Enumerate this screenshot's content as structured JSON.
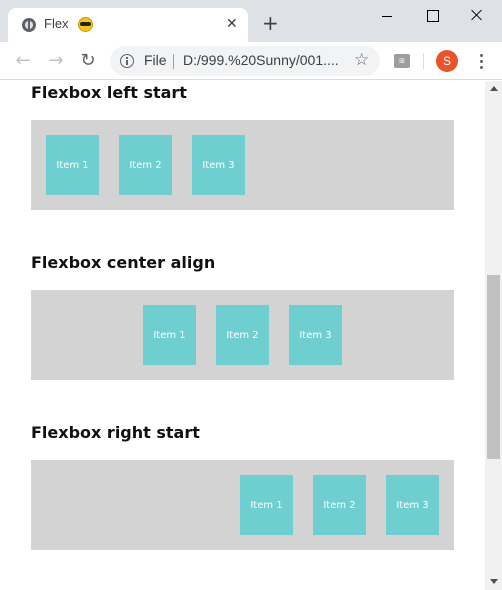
{
  "browser": {
    "tab_title": "Flex",
    "tab_emoji": "sunglasses-face",
    "close_glyph": "✕",
    "new_tab_glyph": "+",
    "back_glyph": "←",
    "forward_glyph": "→",
    "reload_glyph": "↻",
    "omnibox_scheme_label": "File",
    "omnibox_url": "D:/999.%20Sunny/001....",
    "star_glyph": "☆",
    "extension_label": "⊞",
    "avatar_initial": "S",
    "avatar_color": "#e9542a"
  },
  "page": {
    "sections": [
      {
        "title": "Flexbox left start",
        "items": [
          "Item 1",
          "Item 2",
          "Item 3"
        ]
      },
      {
        "title": "Flexbox center align",
        "items": [
          "Item 1",
          "Item 2",
          "Item 3"
        ]
      },
      {
        "title": "Flexbox right start",
        "items": [
          "Item 1",
          "Item 2",
          "Item 3"
        ]
      }
    ],
    "container_color": "#d3d3d3",
    "item_color": "#6fcecf"
  }
}
